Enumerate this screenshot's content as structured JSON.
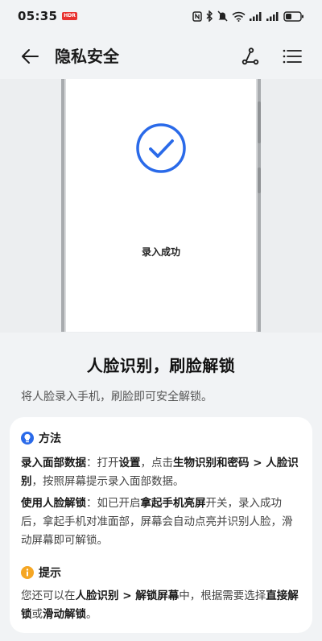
{
  "status_bar": {
    "time": "05:35",
    "hd_badge": "HDR",
    "icons": [
      "nfc-icon",
      "bluetooth-icon",
      "mute-icon",
      "wifi-icon",
      "signal-icon",
      "signal-icon",
      "battery-icon"
    ]
  },
  "header": {
    "title": "隐私安全",
    "back_icon": "arrow-left-icon",
    "route_icon": "route-icon",
    "menu_icon": "list-menu-icon"
  },
  "illustration": {
    "enroll_text": "录入成功",
    "check_icon": "check-circle-icon"
  },
  "headline": "人脸识别，刷脸解锁",
  "subhead": "将人脸录入手机，刷脸即可安全解锁。",
  "method": {
    "title": "方法",
    "icon": "bulb-icon",
    "p1": {
      "b1": "录入面部数据",
      "t1": "：打开",
      "b2": "设置",
      "t2": "，点击",
      "b3": "生物识别和密码 > 人脸识别",
      "t3": "，按照屏幕提示录入面部数据。"
    },
    "p2": {
      "b1": "使用人脸解锁",
      "t1": "：如已开启",
      "b2": "拿起手机亮屏",
      "t2": "开关，录入成功后，拿起手机对准面部，屏幕会自动点亮并识别人脸，滑动屏幕即可解锁。"
    }
  },
  "tip": {
    "title": "提示",
    "icon": "info-icon",
    "p": {
      "t1": "您还可以在",
      "b1": "人脸识别 > 解锁屏幕",
      "t2": "中，根据需要选择",
      "b2": "直接解锁",
      "t3": "或",
      "b3": "滑动解锁",
      "t4": "。"
    }
  },
  "colors": {
    "accent_blue": "#2a6ae9",
    "tip_orange": "#f5a623",
    "background": "#f1f3f5"
  }
}
